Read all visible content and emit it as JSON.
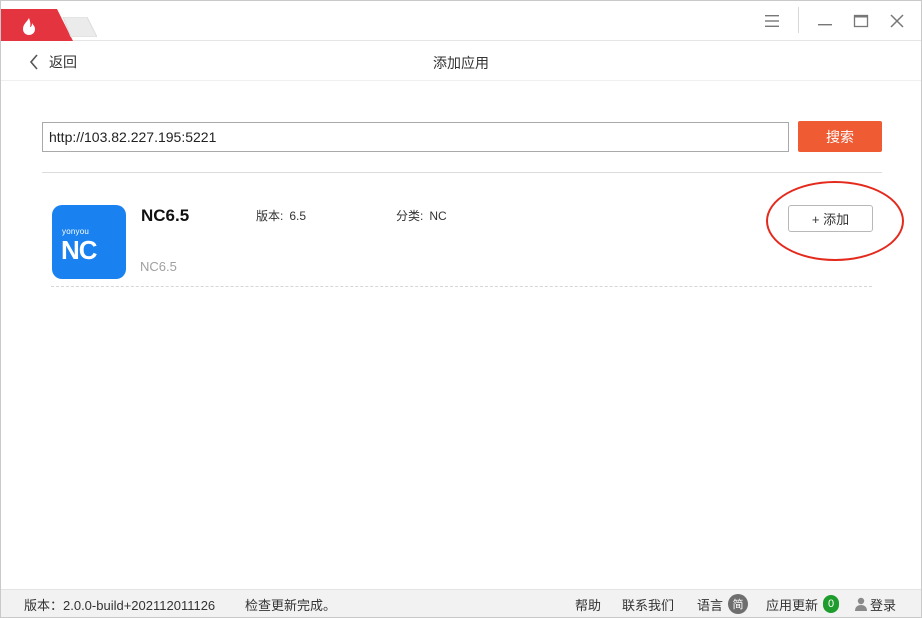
{
  "colors": {
    "brand_red": "#e4343f",
    "search_button": "#ef5b33",
    "app_icon_bg": "#1a82f0",
    "highlight_ring": "#e42a1d",
    "update_badge": "#1e9c2d"
  },
  "titlebar": {
    "app_icon": "flame-icon",
    "menu_icon": "hamburger-menu-icon",
    "minimize_icon": "minimize-icon",
    "maximize_icon": "maximize-icon",
    "close_icon": "close-icon"
  },
  "header": {
    "back_label": "返回",
    "title": "添加应用"
  },
  "search": {
    "value": "http://103.82.227.195:5221",
    "button_label": "搜索"
  },
  "apps": [
    {
      "name": "NC6.5",
      "subtitle": "NC6.5",
      "icon_brand": "yonyou",
      "icon_logo": "NC",
      "version_key": "版本:",
      "version_value": "6.5",
      "category_key": "分类:",
      "category_value": "NC",
      "add_label": "+ 添加"
    }
  ],
  "statusbar": {
    "version": "版本：2.0.0-build+202112011126",
    "check_status": "检查更新完成。",
    "help": "帮助",
    "contact": "联系我们",
    "language": "语言",
    "language_badge": "简",
    "app_update": "应用更新",
    "update_count": "0",
    "login": "登录"
  }
}
